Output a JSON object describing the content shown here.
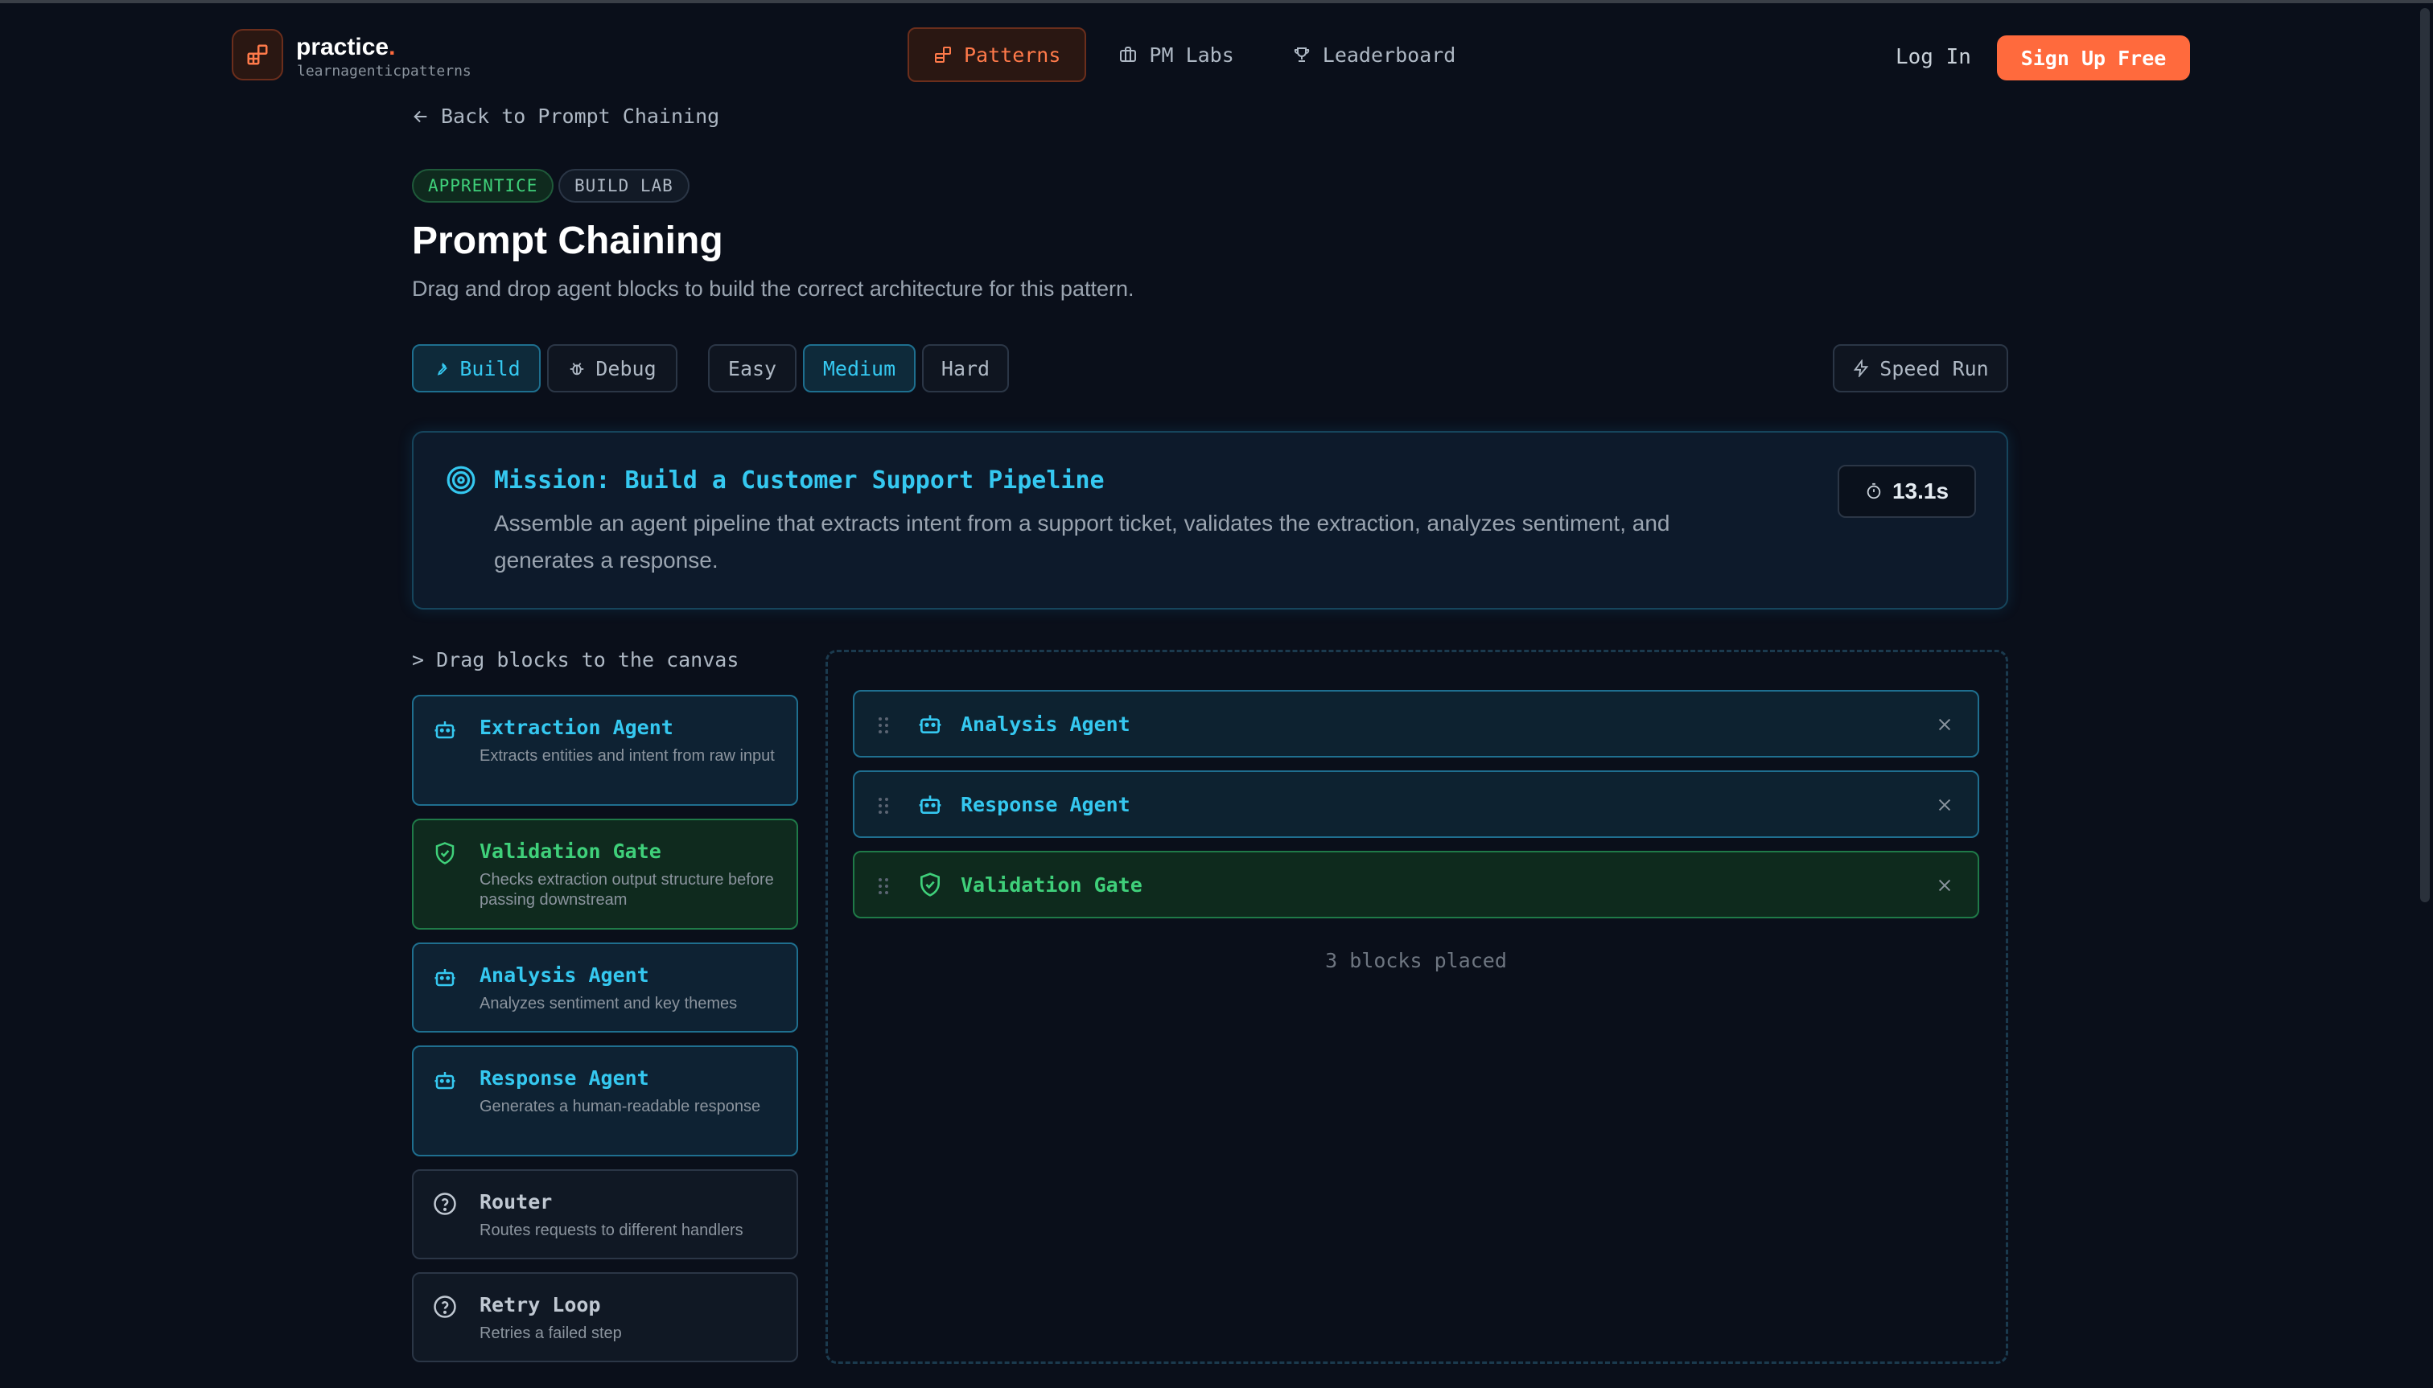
{
  "brand": {
    "name": "practice",
    "dot": ".",
    "sub": "learnagenticpatterns"
  },
  "nav": [
    {
      "label": "Patterns",
      "icon": "blocks-icon",
      "active": true
    },
    {
      "label": "PM Labs",
      "icon": "briefcase-icon",
      "active": false
    },
    {
      "label": "Leaderboard",
      "icon": "trophy-icon",
      "active": false
    }
  ],
  "auth": {
    "login": "Log In",
    "signup": "Sign Up Free"
  },
  "back_link": "Back to Prompt Chaining",
  "badges": {
    "level": "APPRENTICE",
    "type": "BUILD LAB"
  },
  "page": {
    "title": "Prompt Chaining",
    "subtitle": "Drag and drop agent blocks to build the correct architecture for this pattern."
  },
  "modes": {
    "build": "Build",
    "debug": "Debug",
    "selected": "Build"
  },
  "difficulty": {
    "easy": "Easy",
    "medium": "Medium",
    "hard": "Hard",
    "selected": "Medium"
  },
  "speed_run": "Speed Run",
  "mission": {
    "title": "Mission: Build a Customer Support Pipeline",
    "description": "Assemble an agent pipeline that extracts intent from a support ticket, validates the extraction, analyzes sentiment, and generates a response.",
    "timer": "13.1s"
  },
  "palette": {
    "label": "> Drag blocks to the canvas",
    "blocks": [
      {
        "name": "Extraction Agent",
        "desc": "Extracts entities and intent from raw input",
        "icon": "robot-icon",
        "kind": "agent"
      },
      {
        "name": "Validation Gate",
        "desc": "Checks extraction output structure before passing downstream",
        "icon": "shield-check-icon",
        "kind": "gate"
      },
      {
        "name": "Analysis Agent",
        "desc": "Analyzes sentiment and key themes",
        "icon": "robot-icon",
        "kind": "agent"
      },
      {
        "name": "Response Agent",
        "desc": "Generates a human-readable response",
        "icon": "robot-icon",
        "kind": "agent"
      },
      {
        "name": "Router",
        "desc": "Routes requests to different handlers",
        "icon": "help-circle-icon",
        "kind": "other"
      },
      {
        "name": "Retry Loop",
        "desc": "Retries a failed step",
        "icon": "help-circle-icon",
        "kind": "other"
      }
    ]
  },
  "canvas": {
    "placed": [
      {
        "name": "Analysis Agent",
        "icon": "robot-icon",
        "kind": "agent"
      },
      {
        "name": "Response Agent",
        "icon": "robot-icon",
        "kind": "agent"
      },
      {
        "name": "Validation Gate",
        "icon": "shield-check-icon",
        "kind": "gate"
      }
    ],
    "count_label": "3 blocks placed"
  },
  "colors": {
    "accent_orange": "#ff6a3d",
    "accent_cyan": "#35c8f0",
    "accent_green": "#3fd07a",
    "background": "#0a0f1a"
  }
}
